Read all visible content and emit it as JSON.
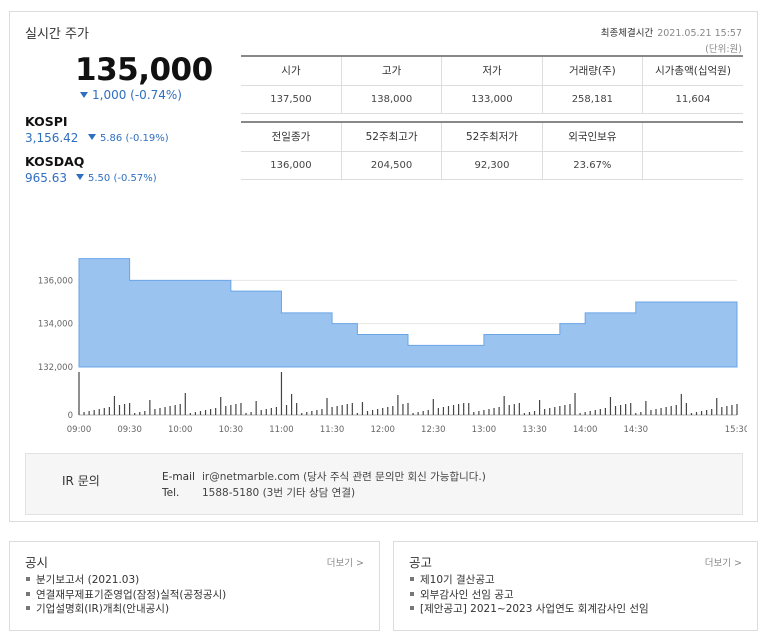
{
  "header": {
    "title": "실시간 주가",
    "last_trade_label": "최종체결시간",
    "last_trade_time": "2021.05.21 15:57",
    "unit": "(단위:원)"
  },
  "price": {
    "current": "135,000",
    "change": "1,000 (-0.74%)"
  },
  "indices": [
    {
      "name": "KOSPI",
      "value": "3,156.42",
      "change": "5.86 (-0.19%)"
    },
    {
      "name": "KOSDAQ",
      "value": "965.63",
      "change": "5.50 (-0.57%)"
    }
  ],
  "stats_top": {
    "headers": [
      "시가",
      "고가",
      "저가",
      "거래량(주)",
      "시가총액(십억원)"
    ],
    "values": [
      "137,500",
      "138,000",
      "133,000",
      "258,181",
      "11,604"
    ]
  },
  "stats_bottom": {
    "headers": [
      "전일종가",
      "52주최고가",
      "52주최저가",
      "외국인보유",
      ""
    ],
    "values": [
      "136,000",
      "204,500",
      "92,300",
      "23.67%",
      ""
    ]
  },
  "chart_data": {
    "type": "area",
    "ylim": [
      132000,
      138000
    ],
    "yticks": [
      "136,000",
      "134,000",
      "132,000"
    ],
    "ytick_values": [
      136000,
      134000,
      132000
    ],
    "volume_ytick": "0",
    "xticks": [
      "09:00",
      "09:30",
      "10:00",
      "10:30",
      "11:00",
      "11:30",
      "12:00",
      "12:30",
      "13:00",
      "13:30",
      "14:00",
      "14:30",
      "15:30"
    ],
    "xtick_minutes": [
      0,
      30,
      60,
      90,
      120,
      150,
      180,
      210,
      240,
      270,
      300,
      330,
      390
    ],
    "x_minutes": [
      0,
      15,
      30,
      45,
      60,
      75,
      90,
      105,
      120,
      135,
      150,
      165,
      180,
      195,
      210,
      225,
      240,
      255,
      270,
      285,
      300,
      315,
      330,
      345,
      360,
      375,
      390
    ],
    "values": [
      137000,
      137000,
      136000,
      136000,
      136000,
      136000,
      135500,
      135500,
      134500,
      134500,
      134000,
      133500,
      133500,
      133000,
      133000,
      133000,
      133500,
      133500,
      133500,
      134000,
      134500,
      134500,
      135000,
      135000,
      135000,
      135000,
      135000
    ],
    "area_color": "#9bc3f0",
    "line_color": "#6aa5e6"
  },
  "ir": {
    "title": "IR 문의",
    "email_label": "E-mail",
    "email_value": "ir@netmarble.com (당사 주식 관련 문의만 회신 가능합니다.)",
    "tel_label": "Tel.",
    "tel_value": "1588-5180 (3번 기타 상담 연결)"
  },
  "notice": {
    "title": "공시",
    "more": "더보기 >",
    "items": [
      "분기보고서 (2021.03)",
      "연결재무제표기준영업(잠정)실적(공정공시)",
      "기업설명회(IR)개최(안내공시)"
    ]
  },
  "announce": {
    "title": "공고",
    "more": "더보기 >",
    "items": [
      "제10기 결산공고",
      "외부감사인 선임 공고",
      "[제안공고] 2021~2023 사업연도 회계감사인 선임"
    ]
  }
}
